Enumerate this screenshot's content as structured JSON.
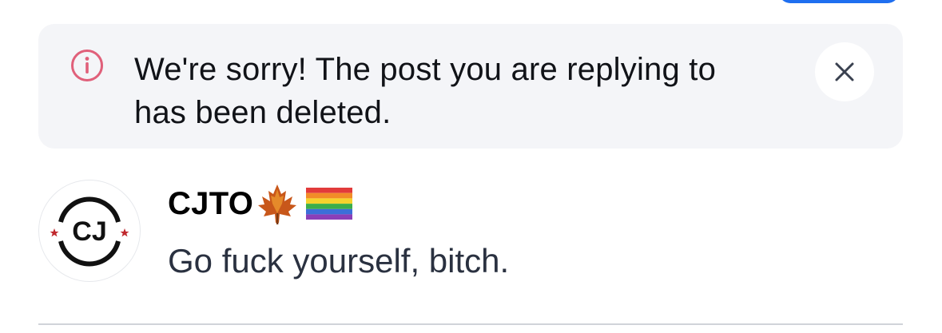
{
  "notice": {
    "message": "We're sorry! The post you are replying to has been deleted.",
    "icon": "info-icon",
    "close_icon": "close-icon",
    "icon_color": "#e0607a"
  },
  "post": {
    "author": "CJTO",
    "author_badges": [
      "maple-leaf-emoji",
      "rainbow-flag-emoji"
    ],
    "avatar_text": "CJ",
    "body": "Go fuck yourself, bitch."
  },
  "colors": {
    "accent": "#1f6ff0",
    "notice_bg": "#f4f5f8",
    "body_text": "#2a3140"
  }
}
